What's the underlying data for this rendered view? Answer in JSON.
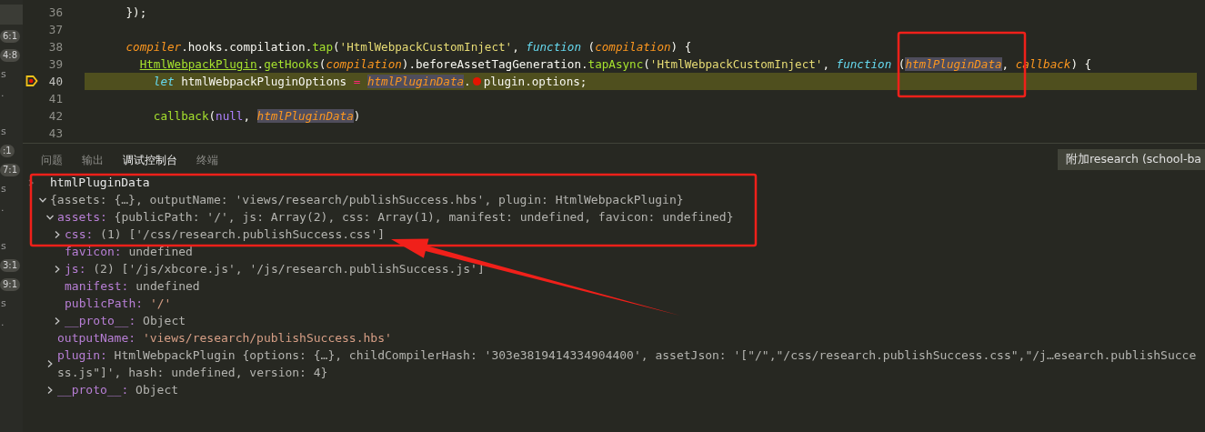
{
  "sidebar_strip": [
    {
      "kind": "badge",
      "text": "6:1"
    },
    {
      "kind": "badge",
      "text": "4:8"
    },
    {
      "kind": "text",
      "text": "s"
    },
    {
      "kind": "text",
      "text": "."
    },
    {
      "kind": "gap"
    },
    {
      "kind": "text",
      "text": "s"
    },
    {
      "kind": "badge",
      "text": ":1"
    },
    {
      "kind": "badge",
      "text": "7:1"
    },
    {
      "kind": "text",
      "text": "s"
    },
    {
      "kind": "text",
      "text": "."
    },
    {
      "kind": "gap"
    },
    {
      "kind": "text",
      "text": "s"
    },
    {
      "kind": "badge",
      "text": "3:1"
    },
    {
      "kind": "badge",
      "text": "9:1"
    },
    {
      "kind": "text",
      "text": "s"
    },
    {
      "kind": "text",
      "text": "."
    }
  ],
  "editor": {
    "lines": [
      {
        "number": "36",
        "current": false,
        "tokens": [
          {
            "kind": "plain",
            "text": "      });"
          }
        ]
      },
      {
        "number": "37",
        "current": false
      },
      {
        "number": "38",
        "current": false,
        "tokens": [
          {
            "kind": "param",
            "text": "      compiler"
          },
          {
            "kind": "plain",
            "text": ".hooks.compilation."
          },
          {
            "kind": "call",
            "text": "tap"
          },
          {
            "kind": "plain",
            "text": "("
          },
          {
            "kind": "string",
            "text": "'HtmlWebpackCustomInject'"
          },
          {
            "kind": "plain",
            "text": ", "
          },
          {
            "kind": "keyword",
            "text": "function"
          },
          {
            "kind": "plain",
            "text": " ("
          },
          {
            "kind": "param",
            "text": "compilation"
          },
          {
            "kind": "plain",
            "text": ") {"
          }
        ]
      },
      {
        "number": "39",
        "current": false,
        "tokens": [
          {
            "kind": "class",
            "text": "        HtmlWebpackPlugin"
          },
          {
            "kind": "plain",
            "text": "."
          },
          {
            "kind": "call",
            "text": "getHooks"
          },
          {
            "kind": "plain",
            "text": "("
          },
          {
            "kind": "param",
            "text": "compilation"
          },
          {
            "kind": "plain",
            "text": ").beforeAssetTagGeneration."
          },
          {
            "kind": "call",
            "text": "tapAsync"
          },
          {
            "kind": "plain",
            "text": "("
          },
          {
            "kind": "string",
            "text": "'HtmlWebpackCustomInject'"
          },
          {
            "kind": "plain",
            "text": ", "
          },
          {
            "kind": "keyword",
            "text": "function"
          },
          {
            "kind": "plain",
            "text": " ("
          },
          {
            "kind": "param-hl",
            "text": "htmlPluginData"
          },
          {
            "kind": "plain",
            "text": ", "
          },
          {
            "kind": "param",
            "text": "callback"
          },
          {
            "kind": "plain",
            "text": ") {"
          }
        ]
      },
      {
        "number": "40",
        "current": true,
        "tokens": [
          {
            "kind": "keyword",
            "text": "          let"
          },
          {
            "kind": "plain",
            "text": " htmlWebpackPluginOptions "
          },
          {
            "kind": "operator",
            "text": "= "
          },
          {
            "kind": "param-hl",
            "text": "htmlPluginData"
          },
          {
            "kind": "plain",
            "text": "."
          },
          {
            "kind": "breakpoint"
          },
          {
            "kind": "plain",
            "text": "plugin.options;"
          }
        ]
      },
      {
        "number": "41",
        "current": false
      },
      {
        "number": "42",
        "current": false,
        "tokens": [
          {
            "kind": "call",
            "text": "          callback"
          },
          {
            "kind": "plain",
            "text": "("
          },
          {
            "kind": "null",
            "text": "null"
          },
          {
            "kind": "plain",
            "text": ", "
          },
          {
            "kind": "param-hl",
            "text": "htmlPluginData"
          },
          {
            "kind": "plain",
            "text": ")"
          }
        ]
      },
      {
        "number": "43",
        "current": false
      }
    ]
  },
  "panel": {
    "tabs": [
      {
        "label": "问题",
        "selected": false
      },
      {
        "label": "输出",
        "selected": false
      },
      {
        "label": "调试控制台",
        "selected": true
      },
      {
        "label": "终端",
        "selected": false
      }
    ],
    "session_select": {
      "value": "附加research (school-ba"
    },
    "console": {
      "expression": "htmlPluginData",
      "result": {
        "value": "{assets: {…}, outputName: 'views/research/publishSuccess.hbs', plugin: HtmlWebpackPlugin}",
        "kind": "preview",
        "expanded": true,
        "children": [
          {
            "key": "assets:",
            "value": "{publicPath: '/', js: Array(2), css: Array(1), manifest: undefined, favicon: undefined}",
            "kind": "preview",
            "expanded": true,
            "children": [
              {
                "key": "css:",
                "value": "(1) ['/css/research.publishSuccess.css']",
                "kind": "preview",
                "expanded": false
              },
              {
                "key": "favicon:",
                "value": "undefined",
                "kind": "preview"
              },
              {
                "key": "js:",
                "value": "(2) ['/js/xbcore.js', '/js/research.publishSuccess.js']",
                "kind": "preview",
                "expanded": false
              },
              {
                "key": "manifest:",
                "value": "undefined",
                "kind": "preview"
              },
              {
                "key": "publicPath:",
                "value": "'/'",
                "kind": "string"
              },
              {
                "key": "__proto__:",
                "value": "Object",
                "kind": "preview",
                "expanded": false
              }
            ]
          },
          {
            "key": "outputName:",
            "value": "'views/research/publishSuccess.hbs'",
            "kind": "string"
          },
          {
            "key": "plugin:",
            "value": "HtmlWebpackPlugin {options: {…}, childCompilerHash: '303e3819414334904400', assetJson: '[\"/\",\"/css/research.publishSuccess.css\",\"/j…esearch.publishSuccess.js\"]', hash: undefined, version: 4}",
            "kind": "preview",
            "expanded": false
          },
          {
            "key": "__proto__:",
            "value": "Object",
            "kind": "preview",
            "expanded": false
          }
        ]
      }
    }
  }
}
